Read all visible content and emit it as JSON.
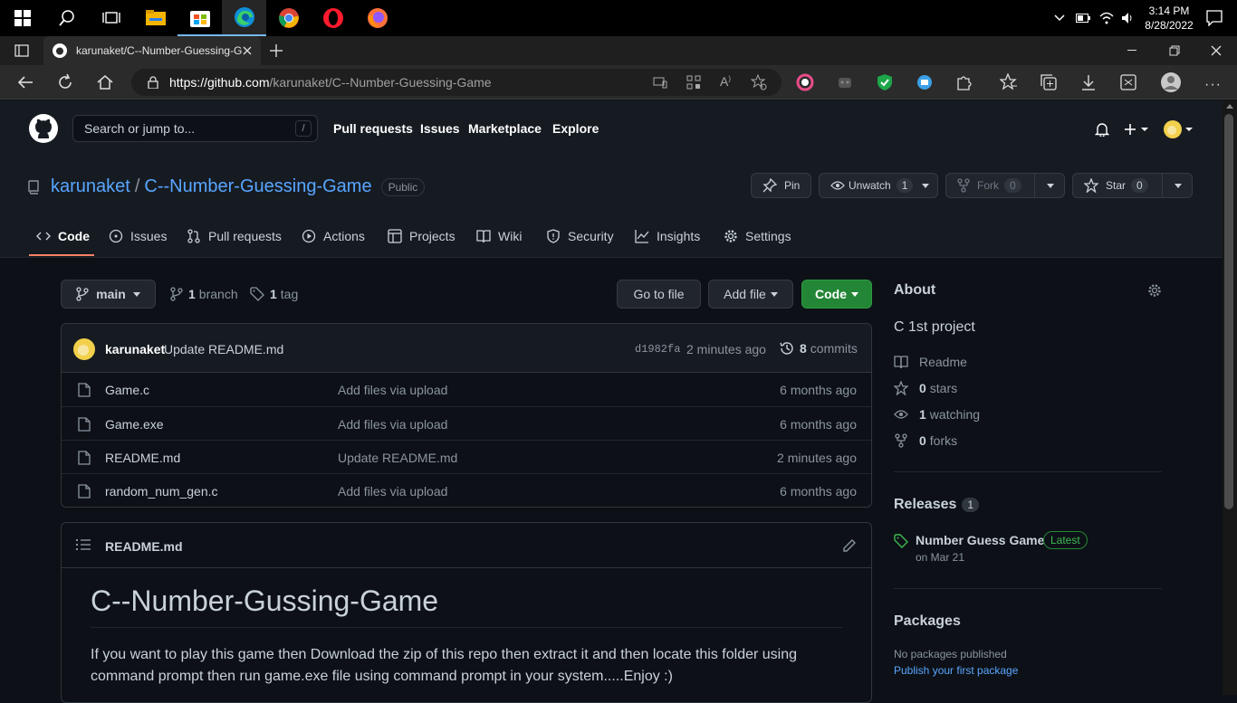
{
  "taskbar": {
    "apps": [
      {
        "name": "search-icon"
      },
      {
        "name": "task-view-icon"
      },
      {
        "name": "file-explorer-icon"
      },
      {
        "name": "store-icon"
      },
      {
        "name": "edge-icon"
      },
      {
        "name": "chrome-icon"
      },
      {
        "name": "opera-icon"
      },
      {
        "name": "firefox-icon"
      }
    ],
    "time": "3:14 PM",
    "date": "8/28/2022"
  },
  "browser": {
    "tab_title": "karunaket/C--Number-Guessing-Game",
    "url_host": "https://github.com",
    "url_path": "/karunaket/C--Number-Guessing-Game"
  },
  "github": {
    "search_placeholder": "Search or jump to...",
    "search_key": "/",
    "nav": [
      "Pull requests",
      "Issues",
      "Marketplace",
      "Explore"
    ]
  },
  "repo": {
    "owner": "karunaket",
    "separator": "/",
    "name": "C--Number-Guessing-Game",
    "visibility": "Public",
    "pin_label": "Pin",
    "watch_label": "Unwatch",
    "watch_count": "1",
    "fork_label": "Fork",
    "fork_count": "0",
    "star_label": "Star",
    "star_count": "0",
    "tabs": [
      "Code",
      "Issues",
      "Pull requests",
      "Actions",
      "Projects",
      "Wiki",
      "Security",
      "Insights",
      "Settings"
    ]
  },
  "toolbar": {
    "branch": "main",
    "branch_count": "1",
    "branch_label": "branch",
    "tag_count": "1",
    "tag_label": "tag",
    "goto_file": "Go to file",
    "add_file": "Add file",
    "code": "Code"
  },
  "commit": {
    "author": "karunaket",
    "message": "Update README.md",
    "sha": "d1982fa",
    "time": "2 minutes ago",
    "commit_count": "8",
    "commit_label": "commits"
  },
  "files": [
    {
      "name": "Game.c",
      "message": "Add files via upload",
      "time": "6 months ago"
    },
    {
      "name": "Game.exe",
      "message": "Add files via upload",
      "time": "6 months ago"
    },
    {
      "name": "README.md",
      "message": "Update README.md",
      "time": "2 minutes ago"
    },
    {
      "name": "random_num_gen.c",
      "message": "Add files via upload",
      "time": "6 months ago"
    }
  ],
  "readme": {
    "filename": "README.md",
    "heading": "C--Number-Gussing-Game",
    "body": "If you want to play this game then Download the zip of this repo then extract it and then locate this folder using command prompt then run game.exe file using command prompt in your system.....Enjoy :)"
  },
  "about": {
    "title": "About",
    "description": "C 1st project",
    "readme": "Readme",
    "stars_count": "0",
    "stars_label": "stars",
    "watching_count": "1",
    "watching_label": "watching",
    "forks_count": "0",
    "forks_label": "forks"
  },
  "releases": {
    "title": "Releases",
    "count": "1",
    "name": "Number Guess Game",
    "badge": "Latest",
    "date": "on Mar 21"
  },
  "packages": {
    "title": "Packages",
    "none": "No packages published",
    "link": "Publish your first package"
  },
  "colors": {
    "accent": "#58a6ff",
    "green": "#238636",
    "tab_underline": "#f78166",
    "bg": "#0d1117"
  }
}
